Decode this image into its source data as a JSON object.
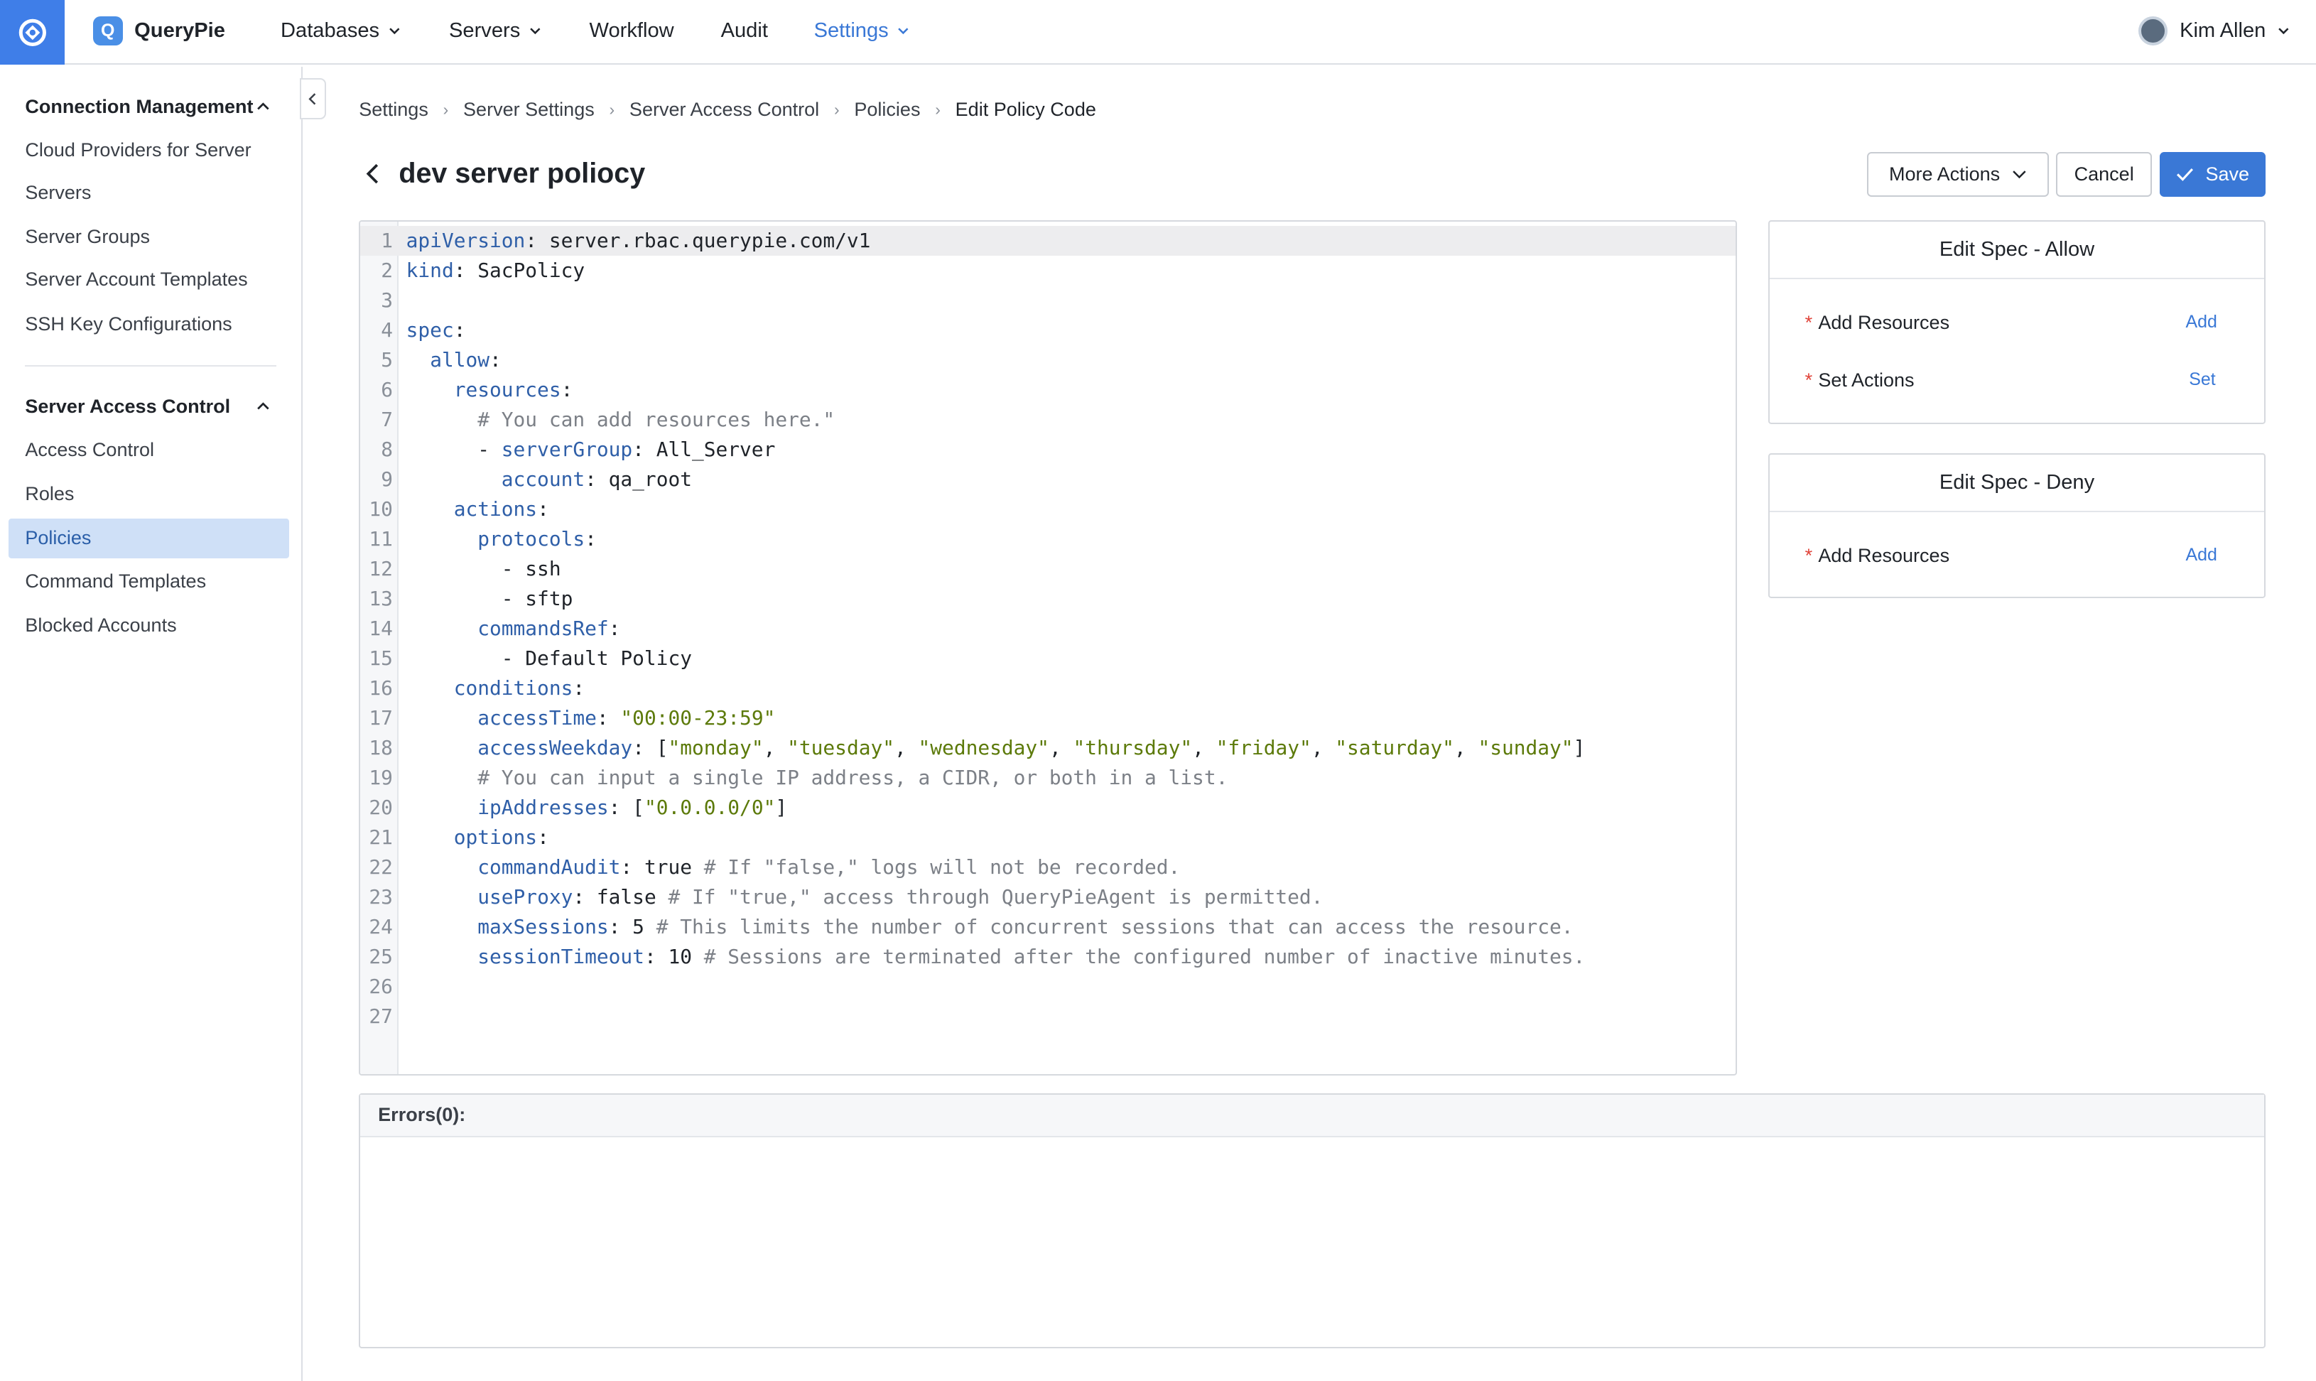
{
  "app": {
    "brand_name": "QueryPie",
    "brand_letter": "Q",
    "accent_color": "#3a78d6"
  },
  "topnav": {
    "items": [
      {
        "label": "Databases",
        "has_dropdown": true
      },
      {
        "label": "Servers",
        "has_dropdown": true
      },
      {
        "label": "Workflow",
        "has_dropdown": false
      },
      {
        "label": "Audit",
        "has_dropdown": false
      },
      {
        "label": "Settings",
        "has_dropdown": true,
        "active": true
      }
    ],
    "user_name": "Kim Allen"
  },
  "sidebar": {
    "sections": [
      {
        "title": "Connection Management",
        "items": [
          "Cloud Providers for Server",
          "Servers",
          "Server Groups",
          "Server Account Templates",
          "SSH Key Configurations"
        ]
      },
      {
        "title": "Server Access Control",
        "items": [
          "Access Control",
          "Roles",
          "Policies",
          "Command Templates",
          "Blocked Accounts"
        ]
      }
    ],
    "active_item": "Policies"
  },
  "breadcrumb": [
    "Settings",
    "Server Settings",
    "Server Access Control",
    "Policies",
    "Edit Policy Code"
  ],
  "page": {
    "title": "dev server poliocy",
    "more_actions_label": "More Actions",
    "cancel_label": "Cancel",
    "save_label": "Save"
  },
  "editor": {
    "lines": [
      "apiVersion: server.rbac.querypie.com/v1",
      "kind: SacPolicy",
      "",
      "spec:",
      "  allow:",
      "    resources:",
      "      # You can add resources here.\"",
      "      - serverGroup: All_Server",
      "        account: qa_root",
      "    actions:",
      "      protocols:",
      "        - ssh",
      "        - sftp",
      "      commandsRef:",
      "        - Default Policy",
      "    conditions:",
      "      accessTime: \"00:00-23:59\"",
      "      accessWeekday: [\"monday\", \"tuesday\", \"wednesday\", \"thursday\", \"friday\", \"saturday\", \"sunday\"]",
      "      # You can input a single IP address, a CIDR, or both in a list.",
      "      ipAddresses: [\"0.0.0.0/0\"]",
      "    options:",
      "      commandAudit: true # If \"false,\" logs will not be recorded.",
      "      useProxy: false # If \"true,\" access through QueryPieAgent is permitted.",
      "      maxSessions: 5 # This limits the number of concurrent sessions that can access the resource.",
      "      sessionTimeout: 10 # Sessions are terminated after the configured number of inactive minutes.",
      "",
      ""
    ],
    "highlighted_line": 1
  },
  "spec_allow": {
    "title": "Edit Spec - Allow",
    "rows": [
      {
        "label": "Add Resources",
        "action": "Add"
      },
      {
        "label": "Set Actions",
        "action": "Set"
      }
    ]
  },
  "spec_deny": {
    "title": "Edit Spec - Deny",
    "rows": [
      {
        "label": "Add Resources",
        "action": "Add"
      }
    ]
  },
  "errors": {
    "label": "Errors(0):"
  }
}
